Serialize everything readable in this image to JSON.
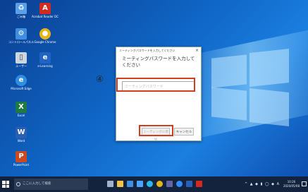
{
  "desktop_icons": [
    {
      "name": "recycle-bin-icon",
      "label": "ごみ箱",
      "color": "#5aa0e6"
    },
    {
      "name": "acrobat-reader-icon",
      "label": "Acrobat Reader DC",
      "color": "#d22a1e"
    },
    {
      "name": "control-panel-icon",
      "label": "コントロールパネル",
      "color": "#3f8ee0"
    },
    {
      "name": "chrome-icon",
      "label": "Google Chrome",
      "color": "#e8b21c"
    },
    {
      "name": "user-folder-icon",
      "label": "ユーザー",
      "color": "#cdd6df"
    },
    {
      "name": "app-e-icon",
      "label": "e-Learning",
      "color": "#1f63c4"
    },
    {
      "name": "edge-icon",
      "label": "Microsoft Edge",
      "color": "#2e8fe0"
    },
    {
      "name": "excel-icon",
      "label": "Excel",
      "color": "#1e7a43"
    },
    {
      "name": "word-icon",
      "label": "Word",
      "color": "#2b5fb4"
    },
    {
      "name": "powerpoint-icon",
      "label": "PowerPoint",
      "color": "#c94a22"
    }
  ],
  "dialog": {
    "title": "ミーティングパスワードを入力してください",
    "close_glyph": "×",
    "message": "ミーティングパスワードを入力してください",
    "input_placeholder": "ミーティングパスワード",
    "ok_label": "ミーティングに参加",
    "cancel_label": "キャンセル"
  },
  "annotation": {
    "step": "④",
    "highlight_color": "#d23d1d"
  },
  "taskbar": {
    "search_placeholder": "ここに入力して検索",
    "apps": [
      {
        "name": "taskview-icon",
        "color": "#9fb3cc"
      },
      {
        "name": "explorer-icon",
        "color": "#f2c24a"
      },
      {
        "name": "store-icon",
        "color": "#3f8ee0"
      },
      {
        "name": "mail-icon",
        "color": "#4aa3ff"
      },
      {
        "name": "edge-taskbar-icon",
        "color": "#2fb6e8"
      },
      {
        "name": "chrome-taskbar-icon",
        "color": "#e8b21c"
      },
      {
        "name": "teams-icon",
        "color": "#6264a7"
      },
      {
        "name": "zoom-icon",
        "color": "#2d8cff"
      },
      {
        "name": "word-taskbar-icon",
        "color": "#2b5fb4"
      },
      {
        "name": "acrobat-taskbar-icon",
        "color": "#d22a1e"
      }
    ],
    "tray_text": "^ ▲ ◆ ▮ ◯ ◆ A",
    "clock_time": "10:26",
    "clock_date": "2020/05/08"
  },
  "colors": {
    "accent": "#d23d1d",
    "desktop": "#0f66c6",
    "taskbar": "#13233e"
  }
}
